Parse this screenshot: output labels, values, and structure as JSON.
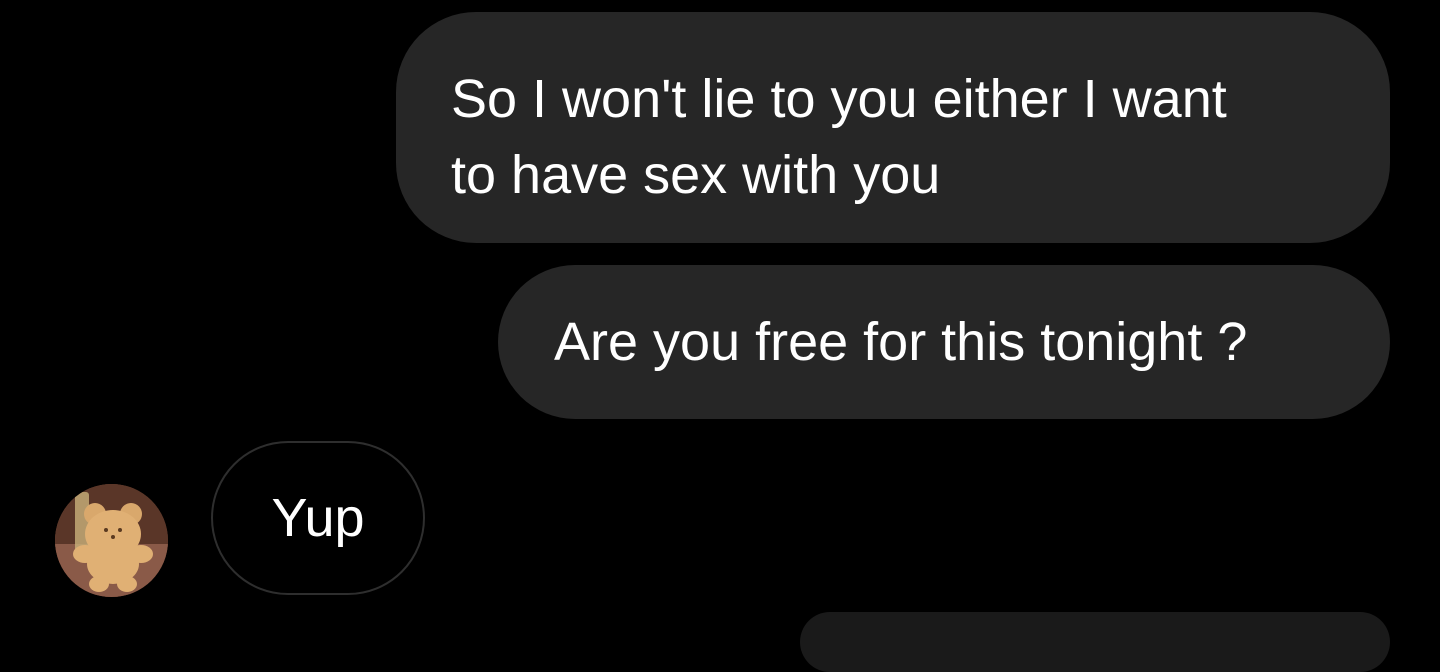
{
  "messages": [
    {
      "direction": "outgoing",
      "text_lines": [
        "So I won't lie to you either I want",
        "to have sex with you"
      ]
    },
    {
      "direction": "outgoing",
      "text": "Are you free for this tonight ?"
    },
    {
      "direction": "incoming",
      "text": "Yup"
    }
  ],
  "avatar": {
    "icon": "bear-cookie-avatar"
  },
  "colors": {
    "background": "#000000",
    "outgoing_bubble": "#262626",
    "incoming_border": "#2e2e2e",
    "text": "#ffffff"
  }
}
